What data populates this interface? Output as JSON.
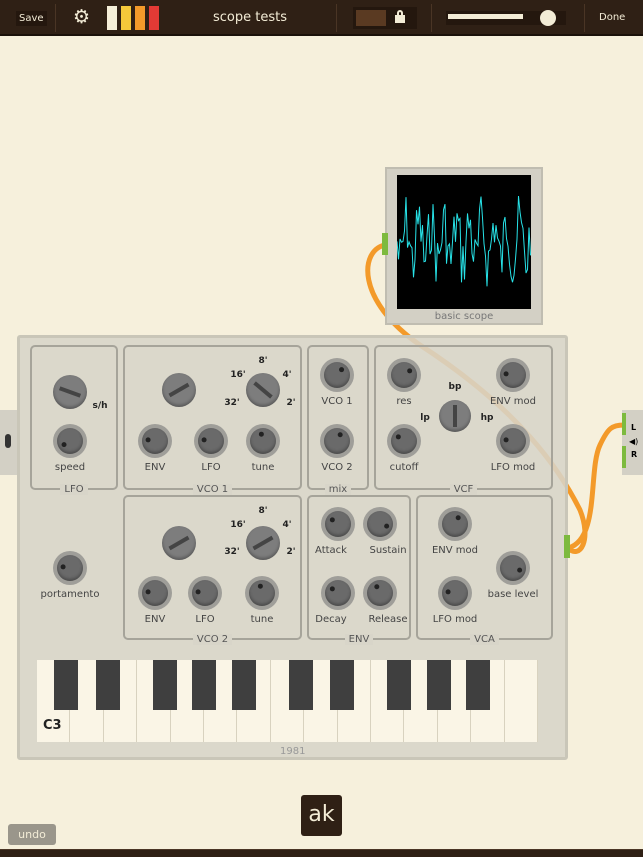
{
  "topbar": {
    "save": "Save",
    "title": "scope tests",
    "done": "Done",
    "swatches": [
      "#f5efd9",
      "#f6c93a",
      "#f39a2a",
      "#e33a35"
    ],
    "volume": 0.75
  },
  "scope": {
    "label": "basic scope"
  },
  "synth": {
    "year": "1981",
    "boxes": {
      "lfo": "LFO",
      "vco1": "VCO 1",
      "mix": "mix",
      "vcf": "VCF",
      "vco2": "VCO 2",
      "env": "ENV",
      "vca": "VCA"
    },
    "vcf_modes": {
      "bp": "bp",
      "lp": "lp",
      "hp": "hp"
    },
    "octaves": [
      "32'",
      "16'",
      "8'",
      "4'",
      "2'"
    ],
    "sh": "s/h",
    "knobs": {
      "lfo_speed": {
        "label": "speed",
        "value": 0.05
      },
      "vco1_env": {
        "label": "ENV",
        "value": 0.2
      },
      "vco1_lfo": {
        "label": "LFO",
        "value": 0.2
      },
      "vco1_tune": {
        "label": "tune",
        "value": 0.45
      },
      "mix_vco1": {
        "label": "VCO 1",
        "value": 0.65
      },
      "mix_vco2": {
        "label": "VCO 2",
        "value": 0.6
      },
      "res": {
        "label": "res",
        "value": 0.7
      },
      "cutoff": {
        "label": "cutoff",
        "value": 0.3
      },
      "vcf_env": {
        "label": "ENV mod",
        "value": 0.2
      },
      "vcf_lfo": {
        "label": "LFO mod",
        "value": 0.2
      },
      "portamento": {
        "label": "portamento",
        "value": 0.2
      },
      "vco2_env": {
        "label": "ENV",
        "value": 0.2
      },
      "vco2_lfo": {
        "label": "LFO",
        "value": 0.2
      },
      "vco2_tune": {
        "label": "tune",
        "value": 0.45
      },
      "attack": {
        "label": "Attack",
        "value": 0.3
      },
      "sustain": {
        "label": "Sustain",
        "value": 0.9
      },
      "decay": {
        "label": "Decay",
        "value": 0.3
      },
      "release": {
        "label": "Release",
        "value": 0.4
      },
      "vca_env": {
        "label": "ENV mod",
        "value": 0.6
      },
      "base_level": {
        "label": "base level",
        "value": 0.9
      },
      "vca_lfo": {
        "label": "LFO mod",
        "value": 0.2
      }
    },
    "keyboard": {
      "octave_label": "C3"
    }
  },
  "output": {
    "left": "L",
    "right": "R"
  },
  "logo": "ak",
  "undo": "undo"
}
